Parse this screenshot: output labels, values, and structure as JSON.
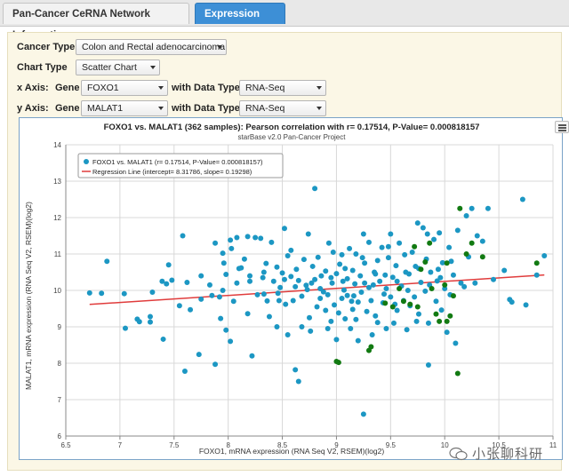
{
  "tabs": [
    {
      "label": "Pan-Cancer CeRNA Network Information",
      "active": false
    },
    {
      "label": "Expression Profile",
      "active": true
    }
  ],
  "form": {
    "cancer_type_label": "Cancer Type",
    "cancer_type_value": "Colon and Rectal adenocarcinoma",
    "chart_type_label": "Chart Type",
    "chart_type_value": "Scatter Chart",
    "x_axis_label": "x Axis:",
    "gene_label": "Gene",
    "x_gene_value": "FOXO1",
    "with_data_type_label": "with Data Type",
    "x_data_type_value": "RNA-Seq",
    "y_axis_label": "y Axis:",
    "y_gene_value": "MALAT1",
    "y_data_type_value": "RNA-Seq"
  },
  "watermark": "小张聊科研",
  "colors": {
    "tab_active": "#3d8fd6",
    "panel_bg": "#fbf7e6",
    "point_main": "#1c97c3",
    "point_highlight": "#127a12",
    "regression": "#e03c3c"
  },
  "chart_data": {
    "type": "scatter",
    "title": "FOXO1 vs. MALAT1 (362 samples): Pearson correlation with r= 0.17514, P-Value= 0.000818157",
    "subtitle": "starBase v2.0 Pan-Cancer Project",
    "xlabel": "FOXO1, mRNA expression (RNA Seq V2, RSEM)(log2)",
    "ylabel": "MALAT1, mRNA expression (RNA Seq V2, RSEM)(log2)",
    "xlim": [
      6.5,
      11
    ],
    "ylim": [
      6,
      14
    ],
    "xticks": [
      "6.5",
      "7",
      "7.5",
      "8",
      "8.5",
      "9",
      "9.5",
      "10",
      "10.5",
      "11"
    ],
    "yticks": [
      "6",
      "7",
      "8",
      "9",
      "10",
      "11",
      "12",
      "13",
      "14"
    ],
    "legend": {
      "position": "top-left",
      "series_label": "FOXO1 vs. MALAT1 (r= 0.17514, P-Value= 0.000818157)",
      "regression_label": "Regression Line (intercept= 8.31786, slope= 0.19298)"
    },
    "regression": {
      "intercept": 8.31786,
      "slope": 0.19298
    },
    "series": [
      {
        "name": "FOXO1 vs. MALAT1 (r= 0.17514, P-Value= 0.000818157)",
        "color": "#1c97c3",
        "points": [
          [
            6.72,
            9.93
          ],
          [
            6.83,
            9.92
          ],
          [
            6.88,
            10.8
          ],
          [
            7.04,
            9.91
          ],
          [
            7.05,
            8.96
          ],
          [
            7.16,
            9.21
          ],
          [
            7.18,
            9.14
          ],
          [
            7.28,
            9.28
          ],
          [
            7.28,
            9.13
          ],
          [
            7.4,
            8.66
          ],
          [
            7.39,
            10.25
          ],
          [
            7.43,
            10.18
          ],
          [
            7.45,
            10.7
          ],
          [
            7.48,
            10.28
          ],
          [
            7.55,
            9.58
          ],
          [
            7.58,
            11.5
          ],
          [
            7.62,
            10.22
          ],
          [
            7.65,
            9.47
          ],
          [
            7.6,
            7.78
          ],
          [
            7.75,
            10.4
          ],
          [
            7.75,
            9.76
          ],
          [
            7.73,
            8.24
          ],
          [
            7.83,
            10.15
          ],
          [
            7.85,
            9.86
          ],
          [
            7.88,
            7.97
          ],
          [
            7.92,
            9.82
          ],
          [
            7.93,
            9.23
          ],
          [
            7.96,
            10.75
          ],
          [
            7.98,
            8.91
          ],
          [
            8.02,
            8.6
          ],
          [
            7.95,
            10.0
          ],
          [
            7.95,
            11.02
          ],
          [
            7.98,
            10.44
          ],
          [
            8.02,
            11.38
          ],
          [
            8.05,
            9.7
          ],
          [
            8.08,
            11.45
          ],
          [
            8.08,
            10.2
          ],
          [
            8.12,
            10.62
          ],
          [
            8.15,
            10.86
          ],
          [
            8.18,
            9.36
          ],
          [
            8.18,
            11.48
          ],
          [
            8.2,
            10.25
          ],
          [
            8.22,
            8.2
          ],
          [
            8.25,
            11.45
          ],
          [
            8.27,
            9.88
          ],
          [
            8.3,
            11.43
          ],
          [
            8.32,
            10.35
          ],
          [
            8.33,
            10.5
          ],
          [
            8.35,
            10.74
          ],
          [
            8.36,
            9.71
          ],
          [
            8.38,
            9.28
          ],
          [
            8.4,
            11.32
          ],
          [
            8.42,
            10.25
          ],
          [
            8.45,
            10.64
          ],
          [
            8.46,
            9.92
          ],
          [
            8.47,
            9.72
          ],
          [
            8.5,
            10.48
          ],
          [
            8.52,
            10.3
          ],
          [
            8.53,
            9.62
          ],
          [
            8.55,
            8.78
          ],
          [
            8.55,
            10.95
          ],
          [
            8.58,
            10.38
          ],
          [
            8.6,
            9.72
          ],
          [
            8.62,
            7.82
          ],
          [
            8.62,
            10.1
          ],
          [
            8.65,
            7.5
          ],
          [
            8.65,
            10.27
          ],
          [
            8.68,
            9.84
          ],
          [
            8.7,
            10.85
          ],
          [
            8.72,
            10.14
          ],
          [
            8.73,
            10.02
          ],
          [
            8.75,
            9.25
          ],
          [
            8.76,
            8.88
          ],
          [
            8.78,
            10.66
          ],
          [
            8.8,
            10.3
          ],
          [
            8.8,
            12.8
          ],
          [
            8.82,
            9.55
          ],
          [
            8.83,
            10.91
          ],
          [
            8.85,
            9.78
          ],
          [
            8.85,
            10.05
          ],
          [
            8.88,
            9.96
          ],
          [
            8.9,
            9.45
          ],
          [
            8.9,
            10.53
          ],
          [
            8.92,
            8.95
          ],
          [
            8.92,
            9.88
          ],
          [
            8.95,
            10.35
          ],
          [
            8.95,
            9.15
          ],
          [
            8.97,
            11.05
          ],
          [
            8.98,
            9.6
          ],
          [
            9.0,
            10.46
          ],
          [
            9.0,
            8.65
          ],
          [
            9.02,
            9.38
          ],
          [
            9.03,
            10.72
          ],
          [
            9.05,
            9.78
          ],
          [
            9.05,
            10.98
          ],
          [
            9.07,
            10.01
          ],
          [
            9.08,
            9.22
          ],
          [
            9.1,
            9.86
          ],
          [
            9.1,
            10.32
          ],
          [
            9.12,
            11.15
          ],
          [
            9.13,
            8.95
          ],
          [
            9.15,
            10.55
          ],
          [
            9.15,
            9.48
          ],
          [
            9.17,
            10.18
          ],
          [
            9.18,
            11.0
          ],
          [
            9.2,
            9.68
          ],
          [
            9.2,
            8.62
          ],
          [
            9.22,
            10.4
          ],
          [
            9.23,
            9.95
          ],
          [
            9.25,
            11.55
          ],
          [
            9.25,
            6.6
          ],
          [
            9.26,
            10.75
          ],
          [
            9.28,
            9.42
          ],
          [
            9.3,
            10.08
          ],
          [
            9.3,
            11.32
          ],
          [
            9.32,
            9.72
          ],
          [
            9.33,
            8.78
          ],
          [
            9.35,
            10.5
          ],
          [
            9.36,
            9.3
          ],
          [
            9.38,
            10.82
          ],
          [
            9.38,
            9.12
          ],
          [
            9.4,
            10.25
          ],
          [
            9.42,
            11.18
          ],
          [
            9.43,
            9.66
          ],
          [
            9.45,
            10.42
          ],
          [
            9.46,
            8.95
          ],
          [
            9.48,
            10.9
          ],
          [
            9.5,
            9.82
          ],
          [
            9.5,
            11.55
          ],
          [
            9.52,
            10.36
          ],
          [
            9.53,
            9.1
          ],
          [
            9.55,
            10.68
          ],
          [
            9.56,
            9.45
          ],
          [
            9.58,
            11.3
          ],
          [
            9.6,
            10.12
          ],
          [
            9.62,
            9.72
          ],
          [
            9.63,
            10.98
          ],
          [
            9.65,
            8.92
          ],
          [
            9.67,
            10.45
          ],
          [
            9.68,
            9.58
          ],
          [
            9.7,
            11.05
          ],
          [
            9.72,
            9.82
          ],
          [
            9.73,
            10.66
          ],
          [
            9.75,
            11.85
          ],
          [
            9.76,
            9.35
          ],
          [
            9.78,
            10.22
          ],
          [
            9.8,
            11.72
          ],
          [
            9.82,
            9.98
          ],
          [
            9.83,
            10.86
          ],
          [
            9.85,
            9.1
          ],
          [
            9.85,
            7.95
          ],
          [
            9.87,
            10.5
          ],
          [
            9.9,
            11.4
          ],
          [
            9.92,
            9.7
          ],
          [
            9.93,
            10.26
          ],
          [
            9.95,
            11.58
          ],
          [
            9.97,
            9.46
          ],
          [
            9.98,
            10.76
          ],
          [
            10.0,
            10.05
          ],
          [
            10.02,
            8.85
          ],
          [
            10.04,
            11.18
          ],
          [
            10.05,
            9.88
          ],
          [
            10.08,
            10.42
          ],
          [
            10.1,
            8.55
          ],
          [
            10.12,
            11.65
          ],
          [
            10.15,
            10.2
          ],
          [
            10.2,
            12.05
          ],
          [
            10.22,
            10.92
          ],
          [
            10.25,
            12.25
          ],
          [
            10.3,
            11.5
          ],
          [
            10.35,
            11.35
          ],
          [
            10.4,
            12.25
          ],
          [
            10.45,
            10.3
          ],
          [
            10.55,
            10.55
          ],
          [
            10.6,
            9.75
          ],
          [
            10.62,
            9.68
          ],
          [
            10.72,
            12.5
          ],
          [
            10.85,
            10.42
          ],
          [
            10.75,
            9.6
          ],
          [
            10.92,
            10.95
          ],
          [
            7.3,
            9.95
          ],
          [
            7.88,
            11.3
          ],
          [
            8.03,
            11.15
          ],
          [
            8.45,
            9.0
          ],
          [
            8.52,
            11.7
          ],
          [
            8.58,
            11.1
          ],
          [
            8.68,
            9.0
          ],
          [
            8.74,
            11.55
          ],
          [
            8.93,
            11.3
          ],
          [
            9.08,
            10.6
          ],
          [
            9.14,
            9.7
          ],
          [
            9.18,
            9.2
          ],
          [
            9.24,
            10.9
          ],
          [
            9.34,
            10.15
          ],
          [
            9.44,
            9.9
          ],
          [
            9.48,
            11.2
          ],
          [
            9.54,
            9.62
          ],
          [
            9.64,
            10.5
          ],
          [
            9.74,
            9.15
          ],
          [
            9.84,
            11.55
          ],
          [
            9.94,
            10.58
          ],
          [
            10.06,
            10.8
          ],
          [
            10.18,
            10.1
          ],
          [
            10.28,
            10.2
          ],
          [
            8.1,
            10.6
          ],
          [
            8.2,
            10.4
          ],
          [
            8.33,
            9.9
          ],
          [
            8.48,
            10.08
          ],
          [
            8.63,
            10.58
          ],
          [
            8.77,
            10.2
          ],
          [
            8.86,
            10.4
          ],
          [
            8.96,
            10.2
          ],
          [
            9.06,
            10.25
          ],
          [
            9.16,
            9.85
          ],
          [
            9.26,
            10.2
          ],
          [
            9.36,
            10.45
          ],
          [
            9.46,
            10.05
          ],
          [
            9.56,
            10.25
          ],
          [
            9.66,
            10.0
          ],
          [
            9.76,
            10.6
          ],
          [
            9.86,
            10.15
          ],
          [
            9.96,
            10.35
          ]
        ]
      },
      {
        "name": "highlighted",
        "color": "#127a12",
        "points": [
          [
            9.0,
            8.05
          ],
          [
            9.02,
            8.02
          ],
          [
            9.3,
            8.35
          ],
          [
            9.32,
            8.45
          ],
          [
            9.45,
            9.65
          ],
          [
            9.52,
            9.55
          ],
          [
            9.58,
            10.05
          ],
          [
            9.62,
            9.7
          ],
          [
            9.68,
            9.62
          ],
          [
            9.75,
            9.55
          ],
          [
            9.78,
            10.58
          ],
          [
            9.82,
            10.78
          ],
          [
            9.86,
            11.3
          ],
          [
            9.88,
            10.05
          ],
          [
            9.92,
            9.35
          ],
          [
            9.95,
            9.15
          ],
          [
            10.0,
            10.15
          ],
          [
            10.02,
            10.75
          ],
          [
            10.05,
            9.3
          ],
          [
            10.08,
            9.85
          ],
          [
            10.12,
            7.72
          ],
          [
            10.14,
            12.25
          ],
          [
            10.2,
            11.0
          ],
          [
            10.25,
            11.3
          ],
          [
            10.35,
            10.92
          ],
          [
            10.85,
            10.75
          ],
          [
            9.72,
            11.2
          ],
          [
            10.02,
            9.15
          ]
        ]
      }
    ]
  }
}
